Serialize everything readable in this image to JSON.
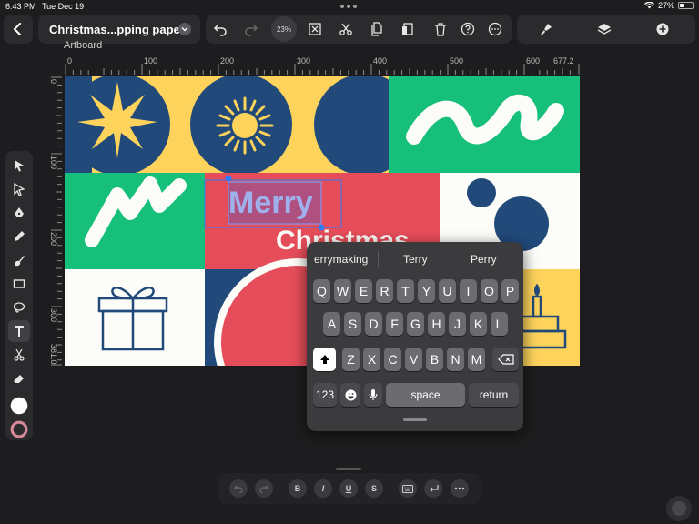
{
  "status": {
    "time": "6:43 PM",
    "date": "Tue Dec 19",
    "battery": "27%"
  },
  "toolbar": {
    "doc_title": "Christmas...pping paper",
    "zoom": "23%"
  },
  "artboard": {
    "label": "Artboard",
    "ruler_top": [
      "0",
      "100",
      "200",
      "300",
      "400",
      "500",
      "600",
      "677.2"
    ],
    "ruler_left": [
      "0",
      "100",
      "200",
      "300",
      "381.0"
    ]
  },
  "canvas_text": {
    "line1": "Merry",
    "line2": "Christmas"
  },
  "keyboard": {
    "suggestions": [
      "errymaking",
      "Terry",
      "Perry"
    ],
    "row1": [
      "Q",
      "W",
      "E",
      "R",
      "T",
      "Y",
      "U",
      "I",
      "O",
      "P"
    ],
    "row2": [
      "A",
      "S",
      "D",
      "F",
      "G",
      "H",
      "J",
      "K",
      "L"
    ],
    "row3": [
      "Z",
      "X",
      "C",
      "V",
      "B",
      "N",
      "M"
    ],
    "num_key": "123",
    "space_key": "space",
    "return_key": "return"
  },
  "format_bar": {
    "bold": "B",
    "italic": "I",
    "underline": "U",
    "strike": "S"
  },
  "colors": {
    "yellow": "#fdd35c",
    "navy": "#214a7a",
    "green": "#16bf7a",
    "red": "#e64d5a",
    "cream": "#fcfcf8",
    "accent": "#2f7bf6"
  }
}
